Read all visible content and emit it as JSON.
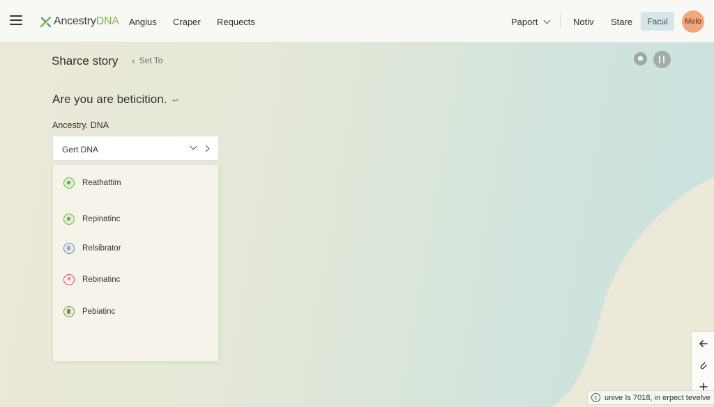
{
  "header": {
    "logo": {
      "text_main": "Ancestry",
      "text_accent": "DNA"
    },
    "nav": [
      "Angius",
      "Craper",
      "Requects"
    ],
    "right_menu": {
      "dropdown_label": "Paport",
      "links": [
        "Notiv",
        "Stare"
      ],
      "pill_label": "Facul"
    },
    "avatar_text": "Melo"
  },
  "page": {
    "title": "Sharce story",
    "back_link": "Set To",
    "question": "Are you are beticition.",
    "question_icon": "↩",
    "field_label": "Ancestry. DNA",
    "select_value": "Gert DNA"
  },
  "dropdown": {
    "options": [
      {
        "label": "Reathattim",
        "icon": "green-badge-icon"
      },
      {
        "label": "Repinatinc",
        "icon": "green-check-icon"
      },
      {
        "label": "Relsibrator",
        "icon": "user-avatar-icon"
      },
      {
        "label": "Rebinatinc",
        "icon": "red-x-icon"
      },
      {
        "label": "Pebiatinc",
        "icon": "green-avatar-icon"
      }
    ]
  },
  "side_tools": [
    "arrow-left-icon",
    "paperclip-icon",
    "plus-icon"
  ],
  "footer": {
    "text": "unive Is 7018, in erpect tevelve"
  },
  "colors": {
    "accent_green": "#7ab648",
    "avatar": "#f0a77a",
    "pill": "#d6e6e8",
    "error_red": "#d04a4a"
  }
}
